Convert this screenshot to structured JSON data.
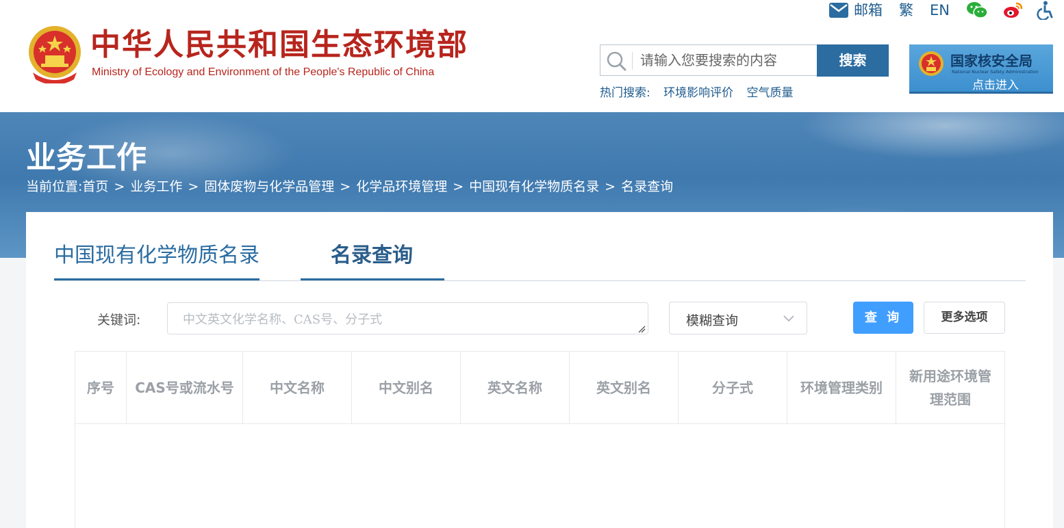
{
  "header": {
    "logo_cn": "中华人民共和国生态环境部",
    "logo_en": "Ministry of Ecology and Environment of the People's Republic of China",
    "top_links": {
      "mail": "邮箱",
      "traditional": "繁",
      "english": "EN"
    },
    "icons": [
      "mail-icon",
      "wechat-icon",
      "weibo-icon",
      "accessibility-icon"
    ],
    "search": {
      "placeholder": "请输入您要搜索的内容",
      "button": "搜索",
      "hot_label": "热门搜索:",
      "hot_items": [
        "环境影响评价",
        "空气质量"
      ]
    },
    "nnsa": {
      "name_cn": "国家核安全局",
      "name_en": "National Nuclear Safety Administration",
      "enter": "点击进入"
    }
  },
  "banner": {
    "title": "业务工作",
    "breadcrumb_label": "当前位置:",
    "breadcrumb": [
      "首页",
      "业务工作",
      "固体废物与化学品管理",
      "化学品环境管理",
      "中国现有化学物质名录",
      "名录查询"
    ]
  },
  "tabs": [
    "中国现有化学物质名录",
    "名录查询"
  ],
  "query": {
    "keyword_label": "关键词:",
    "keyword_value": "",
    "keyword_placeholder": "中文英文化学名称、CAS号、分子式",
    "mode": "模糊查询",
    "query_button": "查 询",
    "more_button": "更多选项"
  },
  "table": {
    "columns": [
      "序号",
      "CAS号或流水号",
      "中文名称",
      "中文别名",
      "英文名称",
      "英文别名",
      "分子式",
      "环境管理类别",
      "新用途环境管理范围"
    ],
    "rows": []
  },
  "colors": {
    "brand_red": "#b7251d",
    "primary_blue": "#2b6ca1",
    "query_button": "#409eff"
  }
}
